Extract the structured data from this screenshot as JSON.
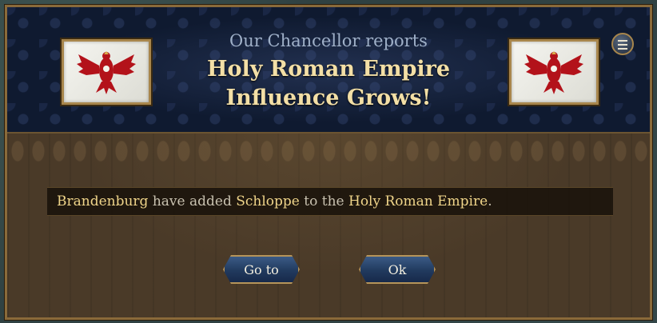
{
  "event": {
    "subtitle": "Our Chancellor reports",
    "title": "Holy Roman Empire Influence Grows!",
    "flag_left_icon": "eagle-flag-icon",
    "flag_right_icon": "eagle-flag-icon",
    "menu_icon": "menu-icon"
  },
  "message": {
    "actor": "Brandenburg",
    "verb": " have added ",
    "province": "Schloppe",
    "connector": " to the ",
    "target": "Holy Roman Empire",
    "end": "."
  },
  "buttons": {
    "goto_label": "Go to",
    "ok_label": "Ok"
  },
  "colors": {
    "header_bg": "#0f1a30",
    "body_bg": "#4a3a28",
    "highlight_text": "#f0d58a",
    "title_text": "#f3dfa6",
    "button_blue": "#213a5e",
    "frame_gold": "#b69459",
    "eagle_red": "#b3121a"
  }
}
